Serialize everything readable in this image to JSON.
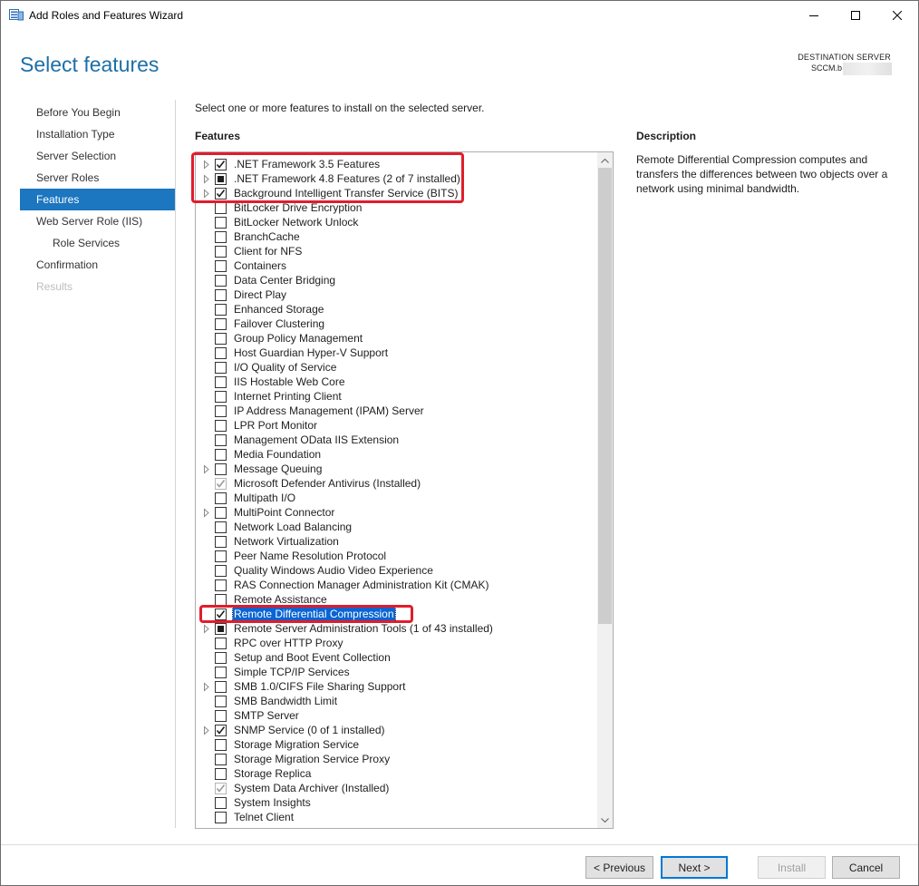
{
  "window": {
    "title": "Add Roles and Features Wizard"
  },
  "header": {
    "page_title": "Select features",
    "destination_label": "DESTINATION SERVER",
    "destination_server": "SCCM.b"
  },
  "nav": {
    "items": [
      {
        "label": "Before You Begin",
        "state": "normal"
      },
      {
        "label": "Installation Type",
        "state": "normal"
      },
      {
        "label": "Server Selection",
        "state": "normal"
      },
      {
        "label": "Server Roles",
        "state": "normal"
      },
      {
        "label": "Features",
        "state": "active"
      },
      {
        "label": "Web Server Role (IIS)",
        "state": "normal"
      },
      {
        "label": "Role Services",
        "state": "sub"
      },
      {
        "label": "Confirmation",
        "state": "normal"
      },
      {
        "label": "Results",
        "state": "disabled"
      }
    ]
  },
  "main": {
    "instruction": "Select one or more features to install on the selected server.",
    "features_label": "Features",
    "features": [
      {
        "label": ".NET Framework 3.5 Features",
        "expandable": true,
        "check": "checked"
      },
      {
        "label": ".NET Framework 4.8 Features (2 of 7 installed)",
        "expandable": true,
        "check": "partial"
      },
      {
        "label": "Background Intelligent Transfer Service (BITS)",
        "expandable": true,
        "check": "checked"
      },
      {
        "label": "BitLocker Drive Encryption",
        "expandable": false,
        "check": "none"
      },
      {
        "label": "BitLocker Network Unlock",
        "expandable": false,
        "check": "none"
      },
      {
        "label": "BranchCache",
        "expandable": false,
        "check": "none"
      },
      {
        "label": "Client for NFS",
        "expandable": false,
        "check": "none"
      },
      {
        "label": "Containers",
        "expandable": false,
        "check": "none"
      },
      {
        "label": "Data Center Bridging",
        "expandable": false,
        "check": "none"
      },
      {
        "label": "Direct Play",
        "expandable": false,
        "check": "none"
      },
      {
        "label": "Enhanced Storage",
        "expandable": false,
        "check": "none"
      },
      {
        "label": "Failover Clustering",
        "expandable": false,
        "check": "none"
      },
      {
        "label": "Group Policy Management",
        "expandable": false,
        "check": "none"
      },
      {
        "label": "Host Guardian Hyper-V Support",
        "expandable": false,
        "check": "none"
      },
      {
        "label": "I/O Quality of Service",
        "expandable": false,
        "check": "none"
      },
      {
        "label": "IIS Hostable Web Core",
        "expandable": false,
        "check": "none"
      },
      {
        "label": "Internet Printing Client",
        "expandable": false,
        "check": "none"
      },
      {
        "label": "IP Address Management (IPAM) Server",
        "expandable": false,
        "check": "none"
      },
      {
        "label": "LPR Port Monitor",
        "expandable": false,
        "check": "none"
      },
      {
        "label": "Management OData IIS Extension",
        "expandable": false,
        "check": "none"
      },
      {
        "label": "Media Foundation",
        "expandable": false,
        "check": "none"
      },
      {
        "label": "Message Queuing",
        "expandable": true,
        "check": "none"
      },
      {
        "label": "Microsoft Defender Antivirus (Installed)",
        "expandable": false,
        "check": "installed"
      },
      {
        "label": "Multipath I/O",
        "expandable": false,
        "check": "none"
      },
      {
        "label": "MultiPoint Connector",
        "expandable": true,
        "check": "none"
      },
      {
        "label": "Network Load Balancing",
        "expandable": false,
        "check": "none"
      },
      {
        "label": "Network Virtualization",
        "expandable": false,
        "check": "none"
      },
      {
        "label": "Peer Name Resolution Protocol",
        "expandable": false,
        "check": "none"
      },
      {
        "label": "Quality Windows Audio Video Experience",
        "expandable": false,
        "check": "none"
      },
      {
        "label": "RAS Connection Manager Administration Kit (CMAK)",
        "expandable": false,
        "check": "none"
      },
      {
        "label": "Remote Assistance",
        "expandable": false,
        "check": "none"
      },
      {
        "label": "Remote Differential Compression",
        "expandable": false,
        "check": "checked",
        "selected": true
      },
      {
        "label": "Remote Server Administration Tools (1 of 43 installed)",
        "expandable": true,
        "check": "partial"
      },
      {
        "label": "RPC over HTTP Proxy",
        "expandable": false,
        "check": "none"
      },
      {
        "label": "Setup and Boot Event Collection",
        "expandable": false,
        "check": "none"
      },
      {
        "label": "Simple TCP/IP Services",
        "expandable": false,
        "check": "none"
      },
      {
        "label": "SMB 1.0/CIFS File Sharing Support",
        "expandable": true,
        "check": "none"
      },
      {
        "label": "SMB Bandwidth Limit",
        "expandable": false,
        "check": "none"
      },
      {
        "label": "SMTP Server",
        "expandable": false,
        "check": "none"
      },
      {
        "label": "SNMP Service (0 of 1 installed)",
        "expandable": true,
        "check": "checked"
      },
      {
        "label": "Storage Migration Service",
        "expandable": false,
        "check": "none"
      },
      {
        "label": "Storage Migration Service Proxy",
        "expandable": false,
        "check": "none"
      },
      {
        "label": "Storage Replica",
        "expandable": false,
        "check": "none"
      },
      {
        "label": "System Data Archiver (Installed)",
        "expandable": false,
        "check": "installed"
      },
      {
        "label": "System Insights",
        "expandable": false,
        "check": "none"
      },
      {
        "label": "Telnet Client",
        "expandable": false,
        "check": "none"
      }
    ]
  },
  "description": {
    "label": "Description",
    "text": "Remote Differential Compression computes and transfers the differences between two objects over a network using minimal bandwidth."
  },
  "footer": {
    "previous_label": "< Previous",
    "next_label": "Next >",
    "install_label": "Install",
    "cancel_label": "Cancel"
  },
  "colors": {
    "title_blue": "#1d6fa8",
    "nav_active": "#1c76c0",
    "selection_blue": "#0a64d2",
    "highlight_red": "#e11d2c"
  }
}
